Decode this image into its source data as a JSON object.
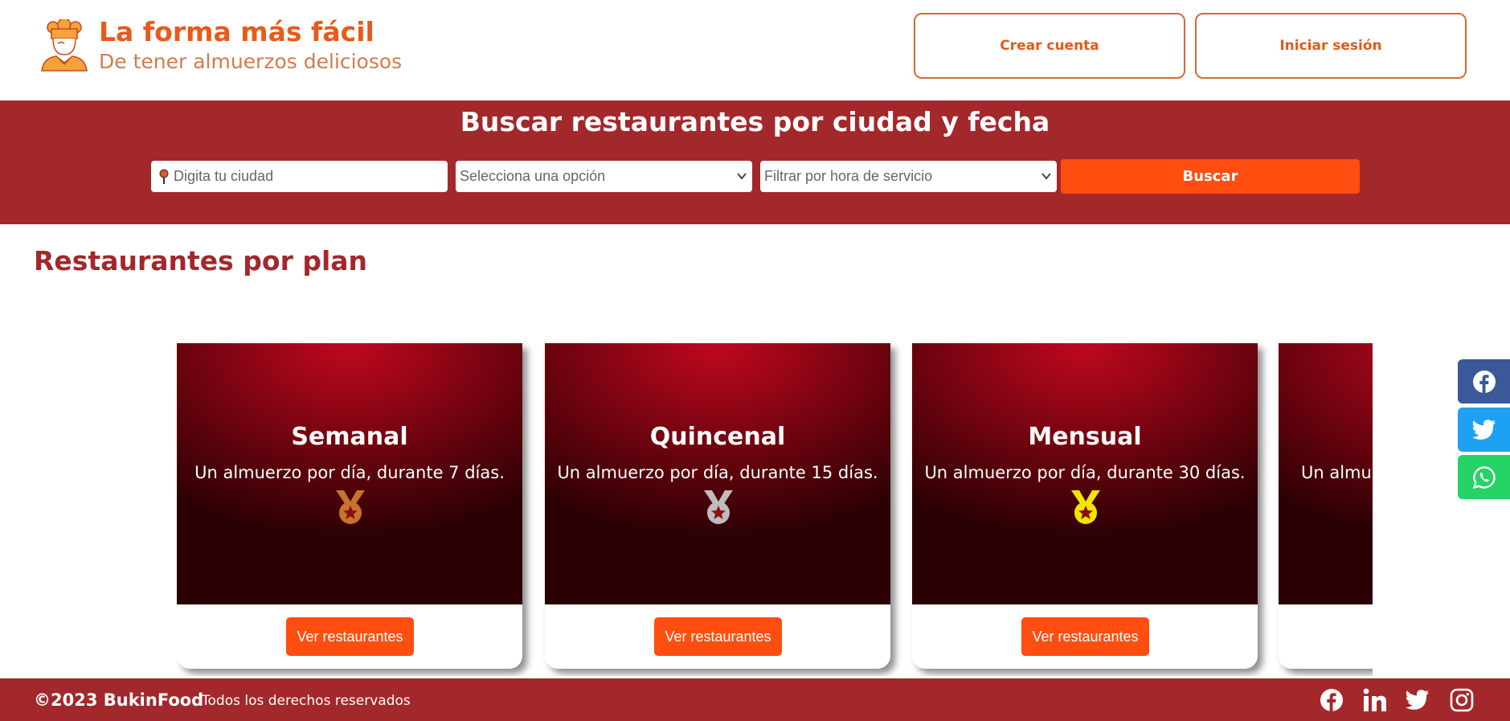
{
  "header": {
    "title": "La forma más fácil",
    "subtitle": "De tener almuerzos deliciosos",
    "create_account": "Crear cuenta",
    "login": "Iniciar sesión"
  },
  "search": {
    "title": "Buscar restaurantes por ciudad y fecha",
    "city_placeholder": "Digita tu ciudad",
    "plan_select": "Selecciona una opción",
    "hour_select": "Filtrar por hora de servicio",
    "button": "Buscar"
  },
  "section": {
    "title": "Restaurantes por plan"
  },
  "plans": [
    {
      "name": "Semanal",
      "desc": "Un almuerzo por día, durante 7 días.",
      "medal_color": "#c8722e",
      "medal_icon": "bronze-medal-icon",
      "button": "Ver restaurantes"
    },
    {
      "name": "Quincenal",
      "desc": "Un almuerzo por día, durante 15 días.",
      "medal_color": "#bdbdbd",
      "medal_icon": "silver-medal-icon",
      "button": "Ver restaurantes"
    },
    {
      "name": "Mensual",
      "desc": "Un almuerzo por día, durante 30 días.",
      "medal_color": "#f5e400",
      "medal_icon": "gold-medal-icon",
      "button": "Ver restaurantes"
    },
    {
      "name": "",
      "desc": "Un almue",
      "medal_color": "",
      "medal_icon": "",
      "button": ""
    }
  ],
  "share": [
    "facebook-icon",
    "twitter-icon",
    "whatsapp-icon"
  ],
  "footer": {
    "copyright": "©2023 BukinFood",
    "rights": "Todos los derechos reservados",
    "social": [
      "facebook-icon",
      "linkedin-icon",
      "twitter-icon",
      "instagram-icon"
    ]
  },
  "colors": {
    "brand_orange": "#ff4e10",
    "brand_red": "#a3282b",
    "title_orange": "#e85a1b"
  }
}
